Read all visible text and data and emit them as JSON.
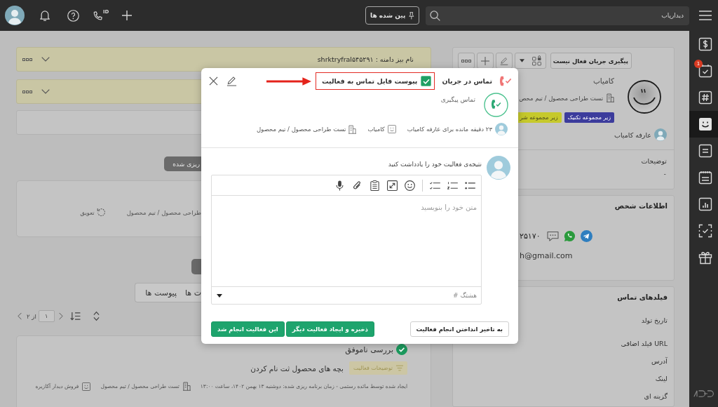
{
  "top_bar": {
    "caller_id_label": "ID",
    "pinned_button": "پین شده ها",
    "search": {
      "placeholder": "دیدارپاب"
    }
  },
  "sidebar": {
    "items": [
      {
        "selected": false
      },
      {
        "selected": false,
        "badge": "1"
      },
      {
        "selected": false
      },
      {
        "selected": true
      },
      {
        "selected": false
      },
      {
        "selected": false
      },
      {
        "selected": false
      },
      {
        "selected": false
      },
      {
        "selected": false
      }
    ]
  },
  "timeline": {
    "domain_bar": "نام بیز دامنه : shrktryfral۵۴۵۲۹۱",
    "scheduled_label": "ریزی شده",
    "postponed_card": {
      "team": "طراحی محصول / تیم محصول",
      "postpone_button": "تعویق"
    },
    "tabs": [
      {
        "label": "ت ها",
        "selected": false
      },
      {
        "label": "پیوست ها",
        "selected": false
      }
    ],
    "pagination": {
      "page": "۱",
      "total": "از ۲"
    },
    "activity": {
      "done": true,
      "title": "بررسی ناموفق",
      "description_button": "توضیحات فعالیت",
      "note": "بچه های محصول ثت نام کردن",
      "meta": "ایجاد شده توسط مائده رستمی - زمان برنامه ریزی شده: دوشنبه ۱۳ بهمن ۱۴۰۲، ساعت ۱۳:۰۰",
      "team": "تست طراحی محصول / تیم محصول",
      "pipeline": "فروش دیدار آکازیره"
    }
  },
  "contact": {
    "flow_button": "پیگیری جریان فعال نیست",
    "name": "کامیاب",
    "team": "تست طراحی محصول / تیم محص",
    "tags": [
      {
        "label": "زیر مجموعه تکنیک",
        "color": "#3c3c9c"
      },
      {
        "label": "زیر مجموعه شر",
        "color": "#c6c92c"
      }
    ],
    "owner": "عارفه کامیاب",
    "description_label": "توضیحات",
    "description": "-"
  },
  "person_info": {
    "title": "اطلاعات شخص",
    "phone": "۲۵۱۷۰",
    "email": "h@gmail.com"
  },
  "contact_fields": {
    "title": "فیلدهای تماس",
    "fields": [
      "تاریخ تولد",
      "فیلد اضافی URL",
      "آدرس",
      "لینک",
      "گزینه ای"
    ]
  },
  "dialog": {
    "status": "تماس در جریان",
    "attach_call": {
      "label": "پیوست فایل تماس به فعالیت",
      "checked": true
    },
    "activity_type": "تماس پیگیری",
    "due": "۲۳ دقیقه مانده برای عارفه کامیاب",
    "contact": "کامیاب",
    "team": "تست طراحی محصول / تیم محصول",
    "prompt": "نتیجه‌ی فعالیت خود را یادداشت کنید",
    "note": {
      "placeholder": "متن خود را بنویسید"
    },
    "hashtag": {
      "placeholder": "هشتگ #"
    },
    "buttons": [
      {
        "label": "به تاخیر انداختن انجام فعالیت",
        "kind": "secondary"
      },
      {
        "label": "ذخیره و ایجاد فعالیت دیگر",
        "kind": "primary"
      },
      {
        "label": "این فعالیت انجام شد",
        "kind": "primary"
      }
    ]
  }
}
